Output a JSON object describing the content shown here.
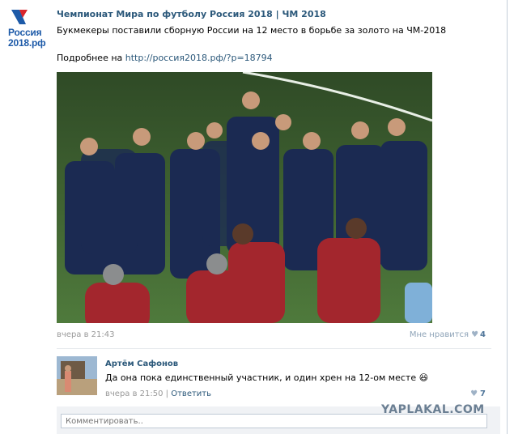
{
  "group": {
    "logo_line1": "Россия",
    "logo_line2": "2018.рф",
    "title": "Чемпионат Мира по футболу Россия 2018 | ЧМ 2018"
  },
  "post": {
    "text": "Букмекеры поставили сборную России на 12 место в борьбе за золото на ЧМ-2018",
    "more_label": "Подробнее на ",
    "link": "http://россия2018.рф/?p=18794",
    "date": "вчера в 21:43",
    "like_label": "Мне нравится",
    "like_count": "4"
  },
  "comment": {
    "author": "Артём Сафонов",
    "text": "Да она пока единственный участник, и один хрен на 12-ом месте 😆",
    "date": "вчера в 21:50",
    "separator": " | ",
    "reply_label": "Ответить",
    "like_count": "7"
  },
  "reply_input": {
    "placeholder": "Комментировать.."
  },
  "watermark": "YAPLAKAL.COM",
  "colors": {
    "link": "#2b587a",
    "meta": "#999999",
    "pitch": "#38582e",
    "shirt": "#1b2a52",
    "staff": "#a3262d"
  },
  "icons": {
    "like": "heart-icon",
    "comment_like": "heart-icon",
    "logo": "russia-2018-logo-icon"
  }
}
